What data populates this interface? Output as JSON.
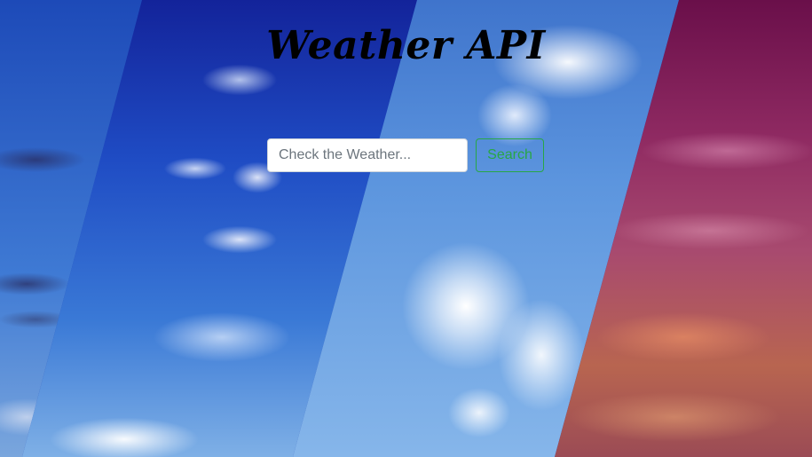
{
  "header": {
    "title": "Weather API"
  },
  "search": {
    "placeholder": "Check the Weather...",
    "value": "",
    "button_label": "Search"
  },
  "colors": {
    "button_accent": "#28a745",
    "title_color": "#000000"
  }
}
